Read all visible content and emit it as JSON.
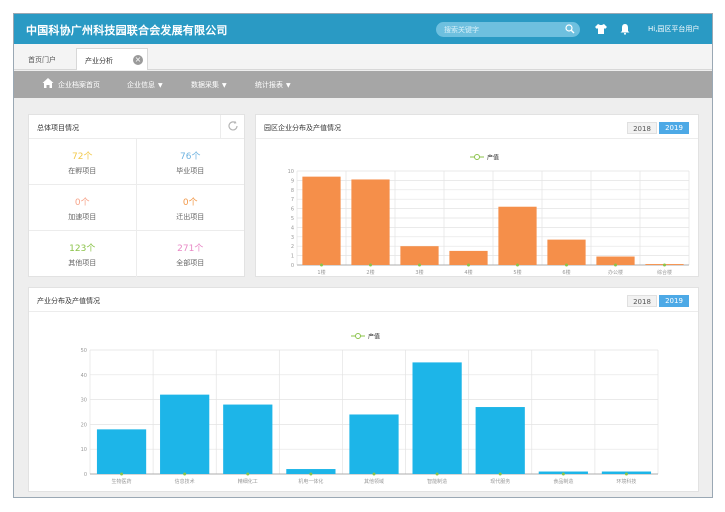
{
  "app": {
    "title": "中国科协广州科技园联合会发展有限公司",
    "search_placeholder": "搜索关键字",
    "user_text": "Hi,园区平台用户"
  },
  "tabs": [
    {
      "label": "首页门户"
    },
    {
      "label": "产业分析"
    }
  ],
  "nav": {
    "items": [
      {
        "label": "企业档案首页"
      },
      {
        "label": "企业信息"
      },
      {
        "label": "数据采集"
      },
      {
        "label": "统计报表"
      }
    ]
  },
  "overview": {
    "title": "总体项目情况",
    "stats": [
      {
        "value": "72个",
        "label": "在孵项目",
        "color": "#f2c94c"
      },
      {
        "value": "76个",
        "label": "毕业项目",
        "color": "#6fb3e0"
      },
      {
        "value": "0个",
        "label": "加速项目",
        "color": "#f7a48a"
      },
      {
        "value": "0个",
        "label": "迁出项目",
        "color": "#f2994a"
      },
      {
        "value": "123个",
        "label": "其他项目",
        "color": "#8bc34a"
      },
      {
        "value": "271个",
        "label": "全部项目",
        "color": "#e889c6"
      }
    ]
  },
  "chart1": {
    "title": "园区企业分布及产值情况",
    "year_tabs": [
      "2018",
      "2019"
    ],
    "active_year": "2019"
  },
  "chart2": {
    "title": "产业分布及产值情况",
    "year_tabs": [
      "2018",
      "2019"
    ],
    "active_year": "2019"
  },
  "colors": {
    "topbar": "#2a9ac4",
    "bar_orange": "#f58f4a",
    "bar_blue": "#1db5e8",
    "legend_green": "#8bc34a",
    "active_year": "#4da9e6"
  },
  "icons": {
    "search": "search-icon",
    "shirt": "shirt-icon",
    "bell": "bell-icon",
    "home": "home-icon",
    "refresh": "refresh-icon",
    "close": "close-icon"
  },
  "chart_data": [
    {
      "type": "bar",
      "legend": [
        "产值"
      ],
      "legend_position": "top-center",
      "grid": true,
      "categories": [
        "1楼",
        "2楼",
        "3楼",
        "4楼",
        "5楼",
        "6楼",
        "办公楼",
        "综合楼"
      ],
      "ylim": [
        0,
        10
      ],
      "yticks": [
        0,
        1,
        2,
        3,
        4,
        5,
        6,
        7,
        8,
        9,
        10
      ],
      "series": [
        {
          "name": "产值",
          "values": [
            9.4,
            9.1,
            2.0,
            1.5,
            6.2,
            2.7,
            0.9,
            0.1
          ],
          "color": "#f58f4a"
        }
      ]
    },
    {
      "type": "bar",
      "legend": [
        "产值"
      ],
      "legend_position": "top-center",
      "grid": true,
      "categories": [
        "生物医药",
        "信息技术",
        "精细化工",
        "机电一体化",
        "其他领域",
        "智能制造",
        "现代服务",
        "食品制造",
        "环境科技"
      ],
      "ylim": [
        0,
        50
      ],
      "yticks": [
        0,
        10,
        20,
        30,
        40,
        50
      ],
      "series": [
        {
          "name": "产值",
          "values": [
            18,
            32,
            28,
            2,
            24,
            45,
            27,
            1,
            1
          ],
          "color": "#1db5e8"
        }
      ]
    }
  ]
}
